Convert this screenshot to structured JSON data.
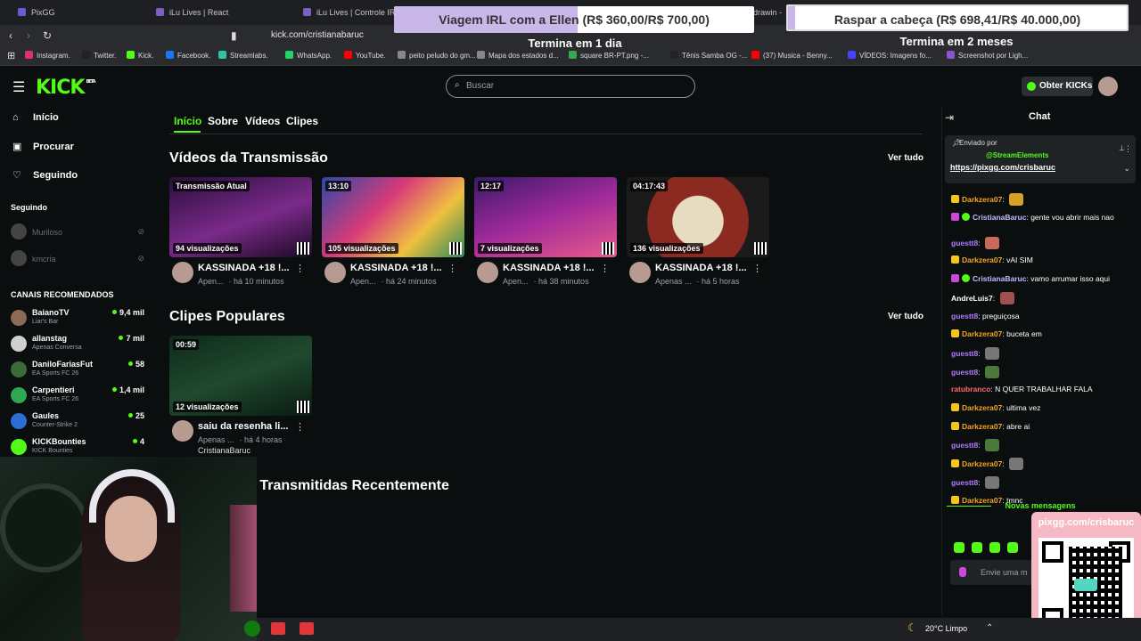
{
  "browser": {
    "tabs": [
      {
        "label": "PixGG",
        "color": "#6b5bd2"
      },
      {
        "label": "iLu Lives | React",
        "color": "#7b5fc4"
      },
      {
        "label": "iLu Lives | Controle IRL",
        "color": "#7b5fc4"
      },
      {
        "label": "iLu Lives |",
        "color": "#7b5fc4"
      },
      {
        "label": "drawin - ",
        "color": "#555555"
      }
    ],
    "url": "kick.com/cristianabaruc",
    "bookmarks": [
      {
        "label": "Instagram.",
        "color": "#e1306c"
      },
      {
        "label": "Twitter.",
        "color": "#222222"
      },
      {
        "label": "Kick.",
        "color": "#53fc18"
      },
      {
        "label": "Facebook.",
        "color": "#1877f2"
      },
      {
        "label": "Streamlabs.",
        "color": "#31c3a2"
      },
      {
        "label": "WhatsApp.",
        "color": "#25d366"
      },
      {
        "label": "YouTube.",
        "color": "#ff0000"
      },
      {
        "label": "peito peludo do gm...",
        "color": "#888888"
      },
      {
        "label": "Mapa dos estados d...",
        "color": "#888888"
      },
      {
        "label": "square BR-PT.png -...",
        "color": "#34a853"
      },
      {
        "label": "Tênis Samba OG -...",
        "color": "#222222"
      },
      {
        "label": "(37) Musica - Benny...",
        "color": "#ff0000"
      },
      {
        "label": "VÍDEOS: Imagens fo...",
        "color": "#4444ff"
      },
      {
        "label": "Screenshot por Ligh...",
        "color": "#8855cc"
      }
    ]
  },
  "overlays": {
    "goal1": {
      "title": "Viagem IRL com a Ellen",
      "amount": "(R$ 360,00/R$ 700,00)",
      "progress": 0.51,
      "sub": "Termina em 1 dia"
    },
    "goal2": {
      "title": "Raspar a cabeça",
      "amount": "(R$ 698,41/R$ 40.000,00)",
      "progress": 0.02,
      "sub": "Termina em 2 meses"
    }
  },
  "header": {
    "logo": "KICK",
    "logo_sup": "BETA",
    "search_placeholder": "Buscar",
    "kicks_button": "Obter KICKs"
  },
  "sidebar": {
    "nav": [
      {
        "label": "Início",
        "icon": "⌂"
      },
      {
        "label": "Procurar",
        "icon": "▣"
      },
      {
        "label": "Seguindo",
        "icon": "♡"
      }
    ],
    "following_title": "Seguindo",
    "following": [
      "Muriloso",
      "kmcria"
    ],
    "recommended_title": "CANAIS RECOMENDADOS",
    "channels": [
      {
        "name": "BaianoTV",
        "game": "Liar's Bar",
        "viewers": "9,4 mil",
        "color": "#8c6a55"
      },
      {
        "name": "allanstag",
        "game": "Apenas Conversa",
        "viewers": "7 mil",
        "color": "#cfcfcf"
      },
      {
        "name": "DaniloFariasFut",
        "game": "EA Sports FC 26",
        "viewers": "58",
        "color": "#3a6b3a"
      },
      {
        "name": "Carpentieri",
        "game": "EA Sports FC 26",
        "viewers": "1,4 mil",
        "color": "#2fa84f"
      },
      {
        "name": "Gaules",
        "game": "Counter-Strike 2",
        "viewers": "25",
        "color": "#2b6fd6"
      },
      {
        "name": "KICKBounties",
        "game": "KICK Bounties",
        "viewers": "4",
        "color": "#53fc18"
      }
    ]
  },
  "main": {
    "tabs": [
      "Início",
      "Sobre",
      "Vídeos",
      "Clipes"
    ],
    "videos_title": "Vídeos da Transmissão",
    "clips_title": "Clipes Populares",
    "recent_title": "s Transmitidas Recentemente",
    "see_all": "Ver tudo",
    "videos": [
      {
        "badge": "Transmissão Atual",
        "views": "94 visualizações",
        "title": "KASSINADA +18 !...",
        "cat": "Apen...",
        "time": "há 10 minutos",
        "bg": "linear-gradient(160deg,#2a0e3a,#7a2a8a 55%,#1a0a22)"
      },
      {
        "badge": "13:10",
        "views": "105 visualizações",
        "title": "KASSINADA +18 !...",
        "cat": "Apen...",
        "time": "há 24 minutos",
        "bg": "linear-gradient(135deg,#2b4aa8,#d83a7a 40%,#f0c040 70%,#2b8a5a)"
      },
      {
        "badge": "12:17",
        "views": "7 visualizações",
        "title": "KASSINADA +18 !...",
        "cat": "Apen...",
        "time": "há 38 minutos",
        "bg": "linear-gradient(160deg,#3a1a6a,#a02a9a 50%,#e85a8a)"
      },
      {
        "badge": "04:17:43",
        "views": "136 visualizações",
        "title": "KASSINADA +18 !...",
        "cat": "Apenas ...",
        "time": "há 5 horas",
        "bg": "radial-gradient(circle at 50% 55%,#e8dcc0 0 30%,#8a2a20 31% 60%,#1a1a1a 61%)"
      }
    ],
    "clips": [
      {
        "badge": "00:59",
        "views": "12 visualizações",
        "title": "saiu da resenha li...",
        "cat": "Apenas ...",
        "time": "há 4 horas",
        "author": "CristianaBaruc",
        "bg": "linear-gradient(160deg,#0e2a1a,#1f4a2f 50%,#0a1a10)"
      }
    ]
  },
  "chat": {
    "title": "Chat",
    "pinned_label": "Enviado por",
    "pinned_user": "@StreamElements",
    "pinned_link": "https://pixgg.com/crisbaruc",
    "new_messages": "Novas mensagens",
    "input_placeholder": "Envie uma m",
    "messages": [
      {
        "user": "Darkzera07",
        "text": "",
        "color": "#f5a623",
        "emote": "#d8a22a",
        "badge": "#f5c518"
      },
      {
        "user": "CristianaBaruc",
        "text": "gente vou abrir mais nao",
        "color": "#c8b8ff",
        "badge": "#53fc18",
        "mic": true
      },
      {
        "user": "guestt8",
        "text": "",
        "color": "#b07cff",
        "emote": "#c86a5a"
      },
      {
        "user": "Darkzera07",
        "text": "vAI SIM",
        "color": "#f5a623",
        "badge": "#f5c518"
      },
      {
        "user": "CristianaBaruc",
        "text": "vamo arrumar isso aqui",
        "color": "#c8b8ff",
        "badge": "#53fc18",
        "mic": true
      },
      {
        "user": "AndreLuis7",
        "text": "",
        "color": "#ffffff",
        "emote": "#a05050"
      },
      {
        "user": "guestt8",
        "text": "preguiçosa",
        "color": "#b07cff"
      },
      {
        "user": "Darkzera07",
        "text": "buceta em",
        "color": "#f5a623",
        "badge": "#f5c518"
      },
      {
        "user": "guestt8",
        "text": "",
        "color": "#b07cff",
        "emote": "#777777"
      },
      {
        "user": "guestt8",
        "text": "",
        "color": "#b07cff",
        "emote": "#4a7a3a"
      },
      {
        "user": "ratubranco",
        "text": "N QUER TRABALHAR FALA",
        "color": "#ff6b6b"
      },
      {
        "user": "Darkzera07",
        "text": "ultima vez",
        "color": "#f5a623",
        "badge": "#f5c518"
      },
      {
        "user": "Darkzera07",
        "text": "abre ai",
        "color": "#f5a623",
        "badge": "#f5c518"
      },
      {
        "user": "guestt8",
        "text": "",
        "color": "#b07cff",
        "emote": "#4a7a3a"
      },
      {
        "user": "Darkzera07",
        "text": "",
        "color": "#f5a623",
        "emote": "#777777",
        "badge": "#f5c518"
      },
      {
        "user": "guestt8",
        "text": "",
        "color": "#b07cff",
        "emote": "#777777"
      },
      {
        "user": "Darkzera07",
        "text": "tmnc",
        "color": "#f5a623",
        "badge": "#f5c518"
      }
    ]
  },
  "qr_panel": {
    "label": "pixgg.com/crisbaruc"
  },
  "taskbar": {
    "weather": "20°C  Limpo"
  }
}
